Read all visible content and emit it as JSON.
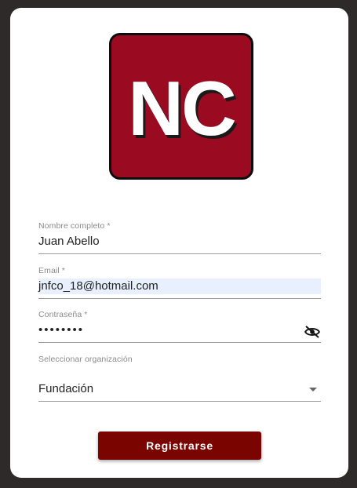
{
  "logo": {
    "text": "NC"
  },
  "form": {
    "name": {
      "label": "Nombre completo *",
      "value": "Juan Abello"
    },
    "email": {
      "label": "Email *",
      "value": "jnfco_18@hotmail.com"
    },
    "password": {
      "label": "Contraseña *",
      "value": "••••••••",
      "toggle_icon": "eye-off-icon"
    },
    "organization": {
      "label": "Seleccionar organización",
      "value": "Fundación"
    }
  },
  "submit_label": "Registrarse"
}
